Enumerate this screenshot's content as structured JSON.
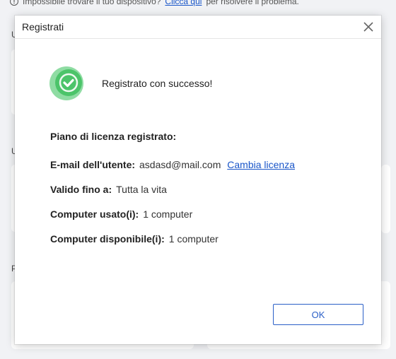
{
  "background": {
    "notice_text": "Impossibile trovare il tuo dispositivo?",
    "notice_link": "Clicca qui",
    "notice_suffix": "per risolvere il problema.",
    "section_letters": [
      "U",
      "U",
      "P"
    ]
  },
  "dialog": {
    "title": "Registrati",
    "success_message": "Registrato con successo!",
    "license_heading": "Piano di licenza registrato:",
    "email_label": "E-mail dell'utente:",
    "email_value": "asdasd@mail.com",
    "change_license_link": "Cambia licenza",
    "valid_label": "Valido fino a:",
    "valid_value": "Tutta la vita",
    "used_label": "Computer usato(i):",
    "used_value": "1 computer",
    "available_label": "Computer disponibile(i):",
    "available_value": "1 computer",
    "ok_label": "OK"
  },
  "colors": {
    "accent": "#2a5fc7",
    "link": "#1a56c9",
    "success_green": "#4cc46a"
  },
  "icons": {
    "success": "check-circle-icon",
    "close": "close-icon",
    "info": "info-icon"
  }
}
